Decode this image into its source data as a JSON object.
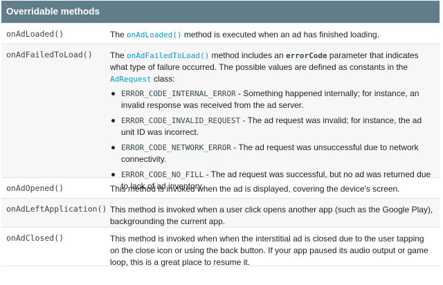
{
  "header": {
    "title": "Overridable methods"
  },
  "rows": [
    {
      "name": "onAdLoaded()",
      "desc": {
        "p1": "The ",
        "code": "onAdLoaded()",
        "p2": " method is executed when an ad has finished loading."
      }
    },
    {
      "name": "onAdFailedToLoad()",
      "desc": {
        "p1": "The ",
        "code1": "onAdFailedToLoad()",
        "p2": " method includes an ",
        "code2": "errorCode",
        "p3": " parameter that indicates what type of failure occurred. The possible values are defined as constants in the ",
        "code3": "AdRequest",
        "p4": " class:"
      },
      "errors": [
        {
          "code": "ERROR_CODE_INTERNAL_ERROR",
          "text": " - Something happened internally; for instance, an invalid response was received from the ad server."
        },
        {
          "code": "ERROR_CODE_INVALID_REQUEST",
          "text": " - The ad request was invalid; for instance, the ad unit ID was incorrect."
        },
        {
          "code": "ERROR_CODE_NETWORK_ERROR",
          "text": " - The ad request was unsuccessful due to network connectivity."
        },
        {
          "code": "ERROR_CODE_NO_FILL",
          "text": " - The ad request was successful, but no ad was returned due to lack of ad inventory."
        }
      ]
    },
    {
      "name": "onAdOpened()",
      "desc": {
        "text": "This method is invoked when the ad is displayed, covering the device's screen."
      }
    },
    {
      "name": "onAdLeftApplication()",
      "desc": {
        "text": "This method is invoked when a user click opens another app (such as the Google Play), backgrounding the current app."
      }
    },
    {
      "name": "onAdClosed()",
      "desc": {
        "text": "This method is invoked when when the interstitial ad is closed due to the user tapping on the close icon or using the back button. If your app paused its audio output or game loop, this is a great place to resume it."
      }
    }
  ],
  "colors": {
    "header_bg": "#607d8b",
    "link": "#039be5",
    "row_alt": "#f7f7f7"
  }
}
